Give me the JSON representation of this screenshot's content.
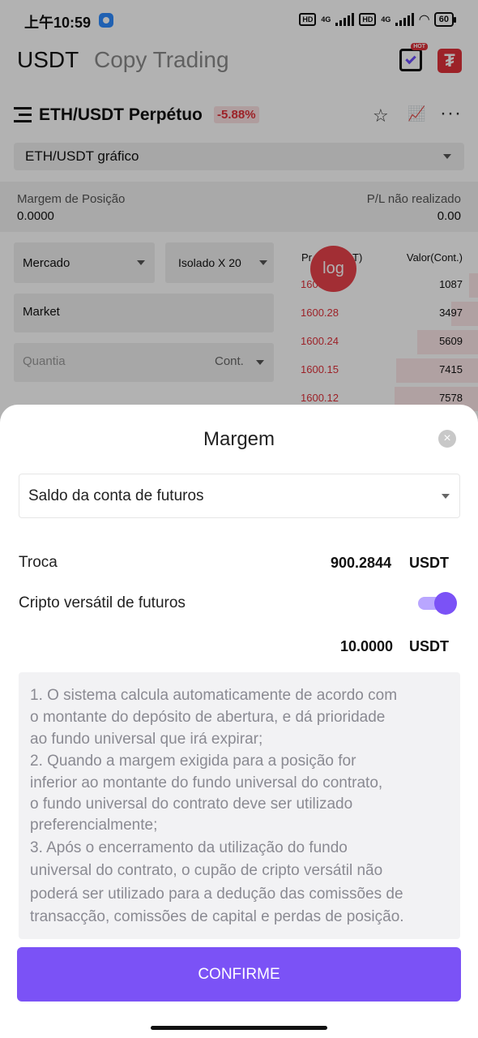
{
  "status_bar": {
    "time": "上午10:59",
    "hd": "HD",
    "net": "4G",
    "battery": "60"
  },
  "header": {
    "tab_active": "USDT",
    "tab_inactive": "Copy Trading",
    "calendar_badge": "HOT",
    "tether_symbol": "₮"
  },
  "pair": {
    "title": "ETH/USDT Perpétuo",
    "change": "-5.88%"
  },
  "chart_selector": "ETH/USDT gráfico",
  "position": {
    "margin_label": "Margem de Posição",
    "margin_value": "0.0000",
    "pl_label": "P/L não realizado",
    "pl_value": "0.00"
  },
  "order_form": {
    "type": "Mercado",
    "leverage": "Isolado X 20",
    "price_field": "Market",
    "quantity_placeholder": "Quantia",
    "unit": "Cont."
  },
  "orderbook": {
    "price_header": "Pr",
    "price_header_tail": "T)",
    "value_header": "Valor(Cont.)",
    "rows": [
      {
        "price": "1600",
        "qty": "1087",
        "depth": 0.05
      },
      {
        "price": "1600.28",
        "qty": "3497",
        "depth": 0.15
      },
      {
        "price": "1600.24",
        "qty": "5609",
        "depth": 0.34
      },
      {
        "price": "1600.15",
        "qty": "7415",
        "depth": 0.46
      },
      {
        "price": "1600.12",
        "qty": "7578",
        "depth": 0.47
      }
    ]
  },
  "log_bubble": "log",
  "sheet": {
    "title": "Margem",
    "source": "Saldo da conta de futuros",
    "exchange_label": "Troca",
    "exchange_amount": "900.2844",
    "exchange_unit": "USDT",
    "versatile_label": "Cripto versátil de futuros",
    "versatile_amount": "10.0000",
    "versatile_unit": "USDT",
    "info_lines": [
      "1. O sistema calcula automaticamente de acordo com",
      "o montante do depósito de abertura, e dá prioridade",
      "ao fundo universal que irá expirar;",
      "2. Quando a margem exigida para a posição for",
      "inferior ao montante do fundo universal do contrato,",
      "o fundo universal do contrato deve ser utilizado",
      "preferencialmente;",
      "3. Após o encerramento da utilização do fundo",
      "universal do contrato, o cupão de cripto versátil não",
      "poderá ser utilizado para a dedução das comissões de",
      "transacção, comissões de capital e perdas de posição."
    ],
    "confirm_label": "CONFIRME"
  },
  "colors": {
    "accent": "#7b52f6",
    "negative": "#e0313a"
  }
}
